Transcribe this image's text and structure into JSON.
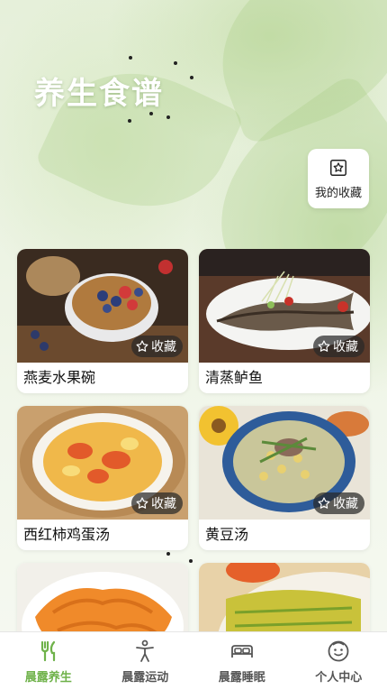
{
  "header": {
    "title": "养生食谱"
  },
  "favorites_button": {
    "label": "我的收藏",
    "icon": "star-box-icon"
  },
  "recipes": [
    {
      "name": "燕麦水果碗",
      "collect_label": "收藏"
    },
    {
      "name": "清蒸鲈鱼",
      "collect_label": "收藏"
    },
    {
      "name": "西红柿鸡蛋汤",
      "collect_label": "收藏"
    },
    {
      "name": "黄豆汤",
      "collect_label": "收藏"
    },
    {
      "name": "",
      "collect_label": ""
    },
    {
      "name": "",
      "collect_label": ""
    }
  ],
  "tabs": [
    {
      "label": "晨露养生",
      "icon": "fork-knife-icon",
      "active": true
    },
    {
      "label": "晨露运动",
      "icon": "exercise-icon",
      "active": false
    },
    {
      "label": "晨露睡眠",
      "icon": "bed-icon",
      "active": false
    },
    {
      "label": "个人中心",
      "icon": "profile-face-icon",
      "active": false
    }
  ],
  "colors": {
    "accent": "#6fb24a",
    "tab_inactive": "#555555"
  }
}
